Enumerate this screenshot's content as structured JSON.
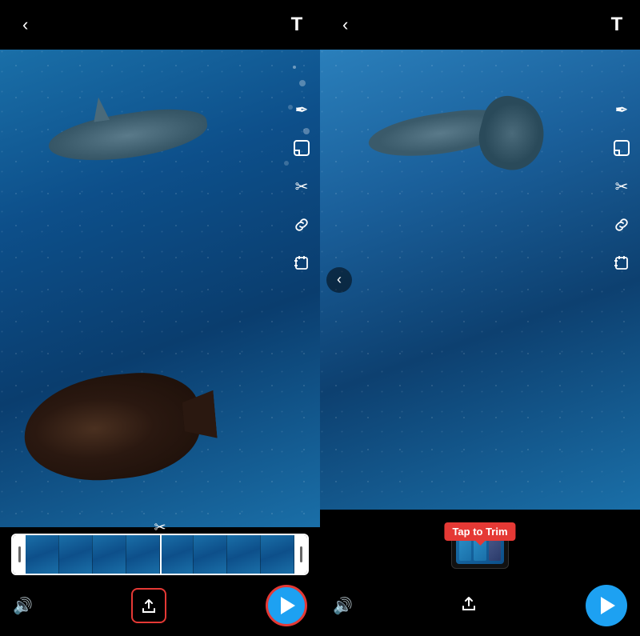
{
  "left_panel": {
    "back_icon": "‹",
    "toolbar": {
      "text_icon": "T",
      "pen_icon": "✏",
      "sticker_icon": "⬛",
      "scissors_icon": "✂",
      "link_icon": "🔗",
      "crop_icon": "⊡"
    },
    "timeline": {
      "scissors_label": "✂",
      "frame_count": 8
    },
    "action_bar": {
      "volume_icon": "🔊",
      "share_label": "⬆",
      "play_label": "▶"
    }
  },
  "right_panel": {
    "back_icon": "‹",
    "toolbar": {
      "text_icon": "T",
      "pen_icon": "✏",
      "sticker_icon": "⬛",
      "scissors_icon": "✂",
      "link_icon": "🔗",
      "crop_icon": "⊡"
    },
    "mid_back_icon": "‹",
    "tooltip": {
      "label": "Tap to Trim"
    },
    "action_bar": {
      "volume_icon": "🔊",
      "share_icon": "⬆",
      "play_label": "▶"
    }
  },
  "colors": {
    "accent_red": "#e53935",
    "play_blue": "#1da1f2",
    "bg": "#000000",
    "timeline_border": "#ffffff",
    "text": "#ffffff"
  }
}
